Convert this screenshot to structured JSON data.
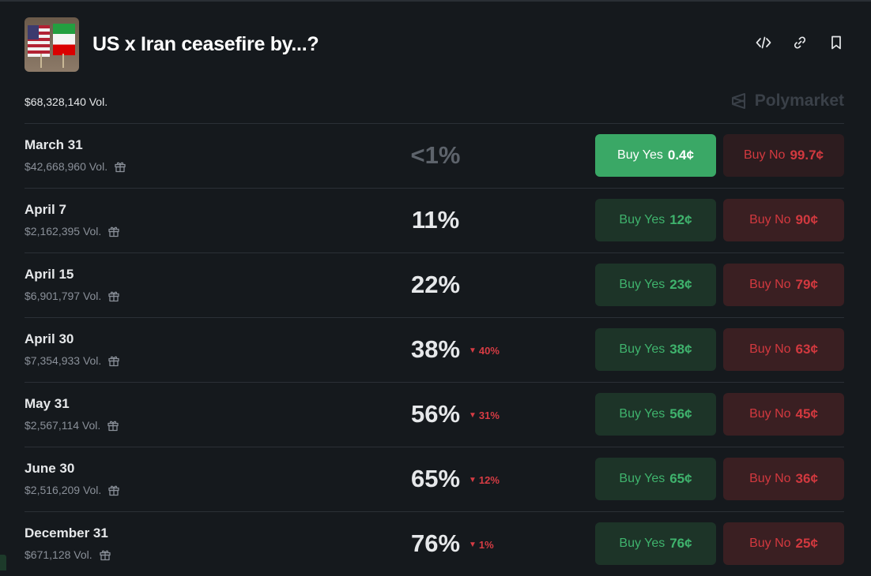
{
  "header": {
    "title": "US x Iran ceasefire by...?",
    "total_volume": "$68,328,140 Vol.",
    "brand": "Polymarket",
    "icons": [
      "embed-icon",
      "link-icon",
      "bookmark-icon"
    ]
  },
  "colors": {
    "background": "#15191d",
    "yes_text": "#3fb36d",
    "yes_bg": "#1d3428",
    "yes_solid": "#3aa866",
    "no_text": "#d2393f",
    "no_bg": "#3a1f22",
    "delta_down": "#d63c44"
  },
  "markets": [
    {
      "date": "March 31",
      "volume": "$42,668,960 Vol.",
      "chance": "<1%",
      "delta": "",
      "yes_label": "Buy Yes",
      "yes_price": "0.4¢",
      "no_label": "Buy No",
      "no_price": "99.7¢"
    },
    {
      "date": "April 7",
      "volume": "$2,162,395 Vol.",
      "chance": "11%",
      "delta": "",
      "yes_label": "Buy Yes",
      "yes_price": "12¢",
      "no_label": "Buy No",
      "no_price": "90¢"
    },
    {
      "date": "April 15",
      "volume": "$6,901,797 Vol.",
      "chance": "22%",
      "delta": "",
      "yes_label": "Buy Yes",
      "yes_price": "23¢",
      "no_label": "Buy No",
      "no_price": "79¢"
    },
    {
      "date": "April 30",
      "volume": "$7,354,933 Vol.",
      "chance": "38%",
      "delta": "40%",
      "yes_label": "Buy Yes",
      "yes_price": "38¢",
      "no_label": "Buy No",
      "no_price": "63¢"
    },
    {
      "date": "May 31",
      "volume": "$2,567,114 Vol.",
      "chance": "56%",
      "delta": "31%",
      "yes_label": "Buy Yes",
      "yes_price": "56¢",
      "no_label": "Buy No",
      "no_price": "45¢"
    },
    {
      "date": "June 30",
      "volume": "$2,516,209 Vol.",
      "chance": "65%",
      "delta": "12%",
      "yes_label": "Buy Yes",
      "yes_price": "65¢",
      "no_label": "Buy No",
      "no_price": "36¢"
    },
    {
      "date": "December 31",
      "volume": "$671,128 Vol.",
      "chance": "76%",
      "delta": "1%",
      "yes_label": "Buy Yes",
      "yes_price": "76¢",
      "no_label": "Buy No",
      "no_price": "25¢"
    }
  ]
}
